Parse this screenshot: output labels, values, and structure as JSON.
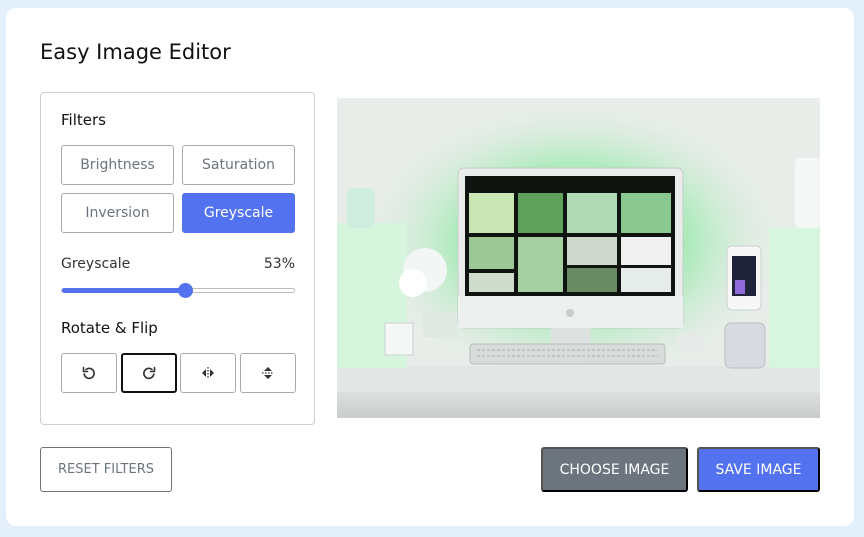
{
  "app": {
    "title": "Easy Image Editor"
  },
  "filters": {
    "heading": "Filters",
    "buttons": [
      {
        "label": "Brightness",
        "active": false
      },
      {
        "label": "Saturation",
        "active": false
      },
      {
        "label": "Inversion",
        "active": false
      },
      {
        "label": "Greyscale",
        "active": true
      }
    ]
  },
  "slider": {
    "name": "Greyscale",
    "value_text": "53%",
    "value": 0.53
  },
  "rotate": {
    "heading": "Rotate & Flip",
    "buttons": [
      {
        "icon": "rotate-left-icon"
      },
      {
        "icon": "rotate-right-icon",
        "focused": true
      },
      {
        "icon": "flip-horizontal-icon"
      },
      {
        "icon": "flip-vertical-icon"
      }
    ]
  },
  "actions": {
    "reset": "RESET FILTERS",
    "choose": "CHOOSE IMAGE",
    "save": "SAVE IMAGE"
  },
  "colors": {
    "accent": "#5372f0",
    "secondary": "#6c757d",
    "background": "#e3f0fb"
  }
}
